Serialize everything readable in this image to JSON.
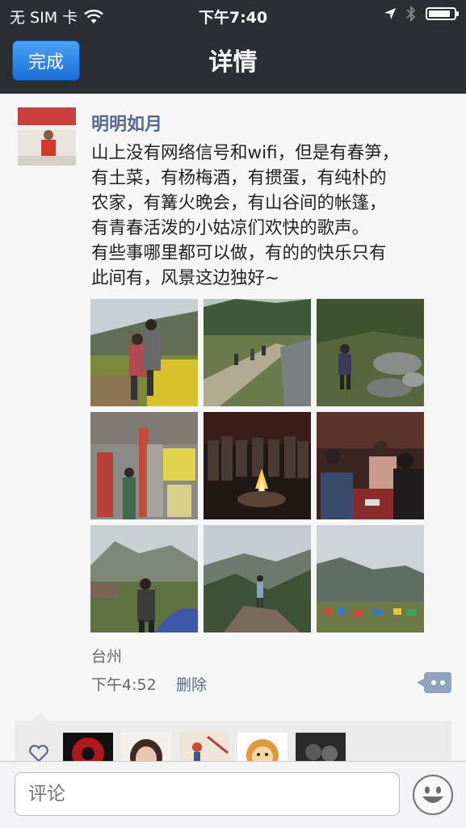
{
  "status_bar": {
    "carrier": "无 SIM 卡",
    "time": "下午7:40",
    "battery_level": 0.85
  },
  "nav": {
    "done_label": "完成",
    "title": "详情"
  },
  "post": {
    "author": "明明如月",
    "text": "山上没有网络信号和wifi，但是有春笋，\n有土菜，有杨梅酒，有掼蛋，有纯朴的\n农家，有篝火晚会，有山谷间的帐篷，\n有青春活泼的小姑凉们欢快的歌声。\n有些事哪里都可以做，有的的快乐只有\n此间有，风景这边独好~",
    "location": "台州",
    "time": "下午4:52",
    "delete_label": "删除"
  },
  "bottom": {
    "comment_placeholder": "评论"
  },
  "icons": {
    "wifi": "wifi-icon",
    "location": "location-arrow-icon",
    "bluetooth": "bluetooth-icon",
    "battery": "battery-icon",
    "comment": "comment-bubble-icon",
    "like": "heart-icon",
    "emoji": "smiley-icon"
  },
  "colors": {
    "bar": "#2b2e33",
    "accent": "#56698f",
    "done_button": "#1a6fd8"
  }
}
